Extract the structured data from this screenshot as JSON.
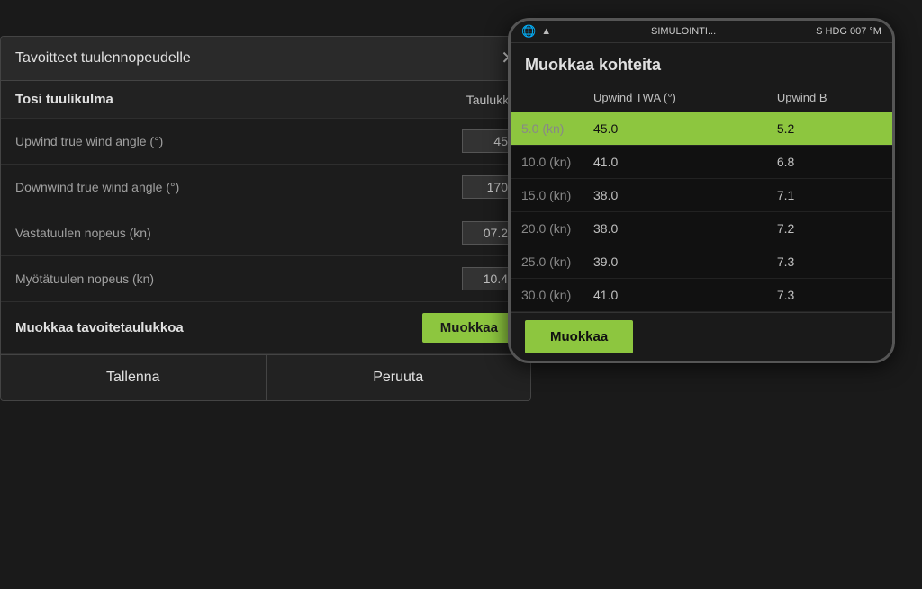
{
  "mainDialog": {
    "title": "Tavoitteet tuulennopeudelle",
    "closeLabel": "✕",
    "sections": {
      "tosiTuulikulma": {
        "label": "Tosi tuulikulma",
        "value": "Taulukko"
      }
    },
    "rows": [
      {
        "label": "Upwind true wind angle (°)",
        "value": "45"
      },
      {
        "label": "Downwind true wind angle (°)",
        "value": "170"
      },
      {
        "label": "Vastatuulen nopeus (kn)",
        "value": "07.2"
      },
      {
        "label": "Myötätuulen nopeus (kn)",
        "value": "10.4"
      }
    ],
    "editRow": {
      "label": "Muokkaa tavoitetaulukkoa",
      "buttonLabel": "Muokkaa"
    },
    "footer": {
      "saveLabel": "Tallenna",
      "cancelLabel": "Peruuta"
    }
  },
  "devicePanel": {
    "statusBar": {
      "leftIcon": "🌐",
      "centerText": "SIMULOINTI...",
      "rightText": "S HDG 007 °M"
    },
    "title": "Muokkaa kohteita",
    "tableHeaders": {
      "col1": "",
      "col2": "Upwind TWA (°)",
      "col3": "Upwind B"
    },
    "tableRows": [
      {
        "windSpeed": "5.0 (kn)",
        "twa": "45.0",
        "b": "5.2",
        "highlighted": true
      },
      {
        "windSpeed": "10.0 (kn)",
        "twa": "41.0",
        "b": "6.8",
        "highlighted": false
      },
      {
        "windSpeed": "15.0 (kn)",
        "twa": "38.0",
        "b": "7.1",
        "highlighted": false
      },
      {
        "windSpeed": "20.0 (kn)",
        "twa": "38.0",
        "b": "7.2",
        "highlighted": false
      },
      {
        "windSpeed": "25.0 (kn)",
        "twa": "39.0",
        "b": "7.3",
        "highlighted": false
      },
      {
        "windSpeed": "30.0 (kn)",
        "twa": "41.0",
        "b": "7.3",
        "highlighted": false
      }
    ],
    "editButtonLabel": "Muokkaa"
  }
}
